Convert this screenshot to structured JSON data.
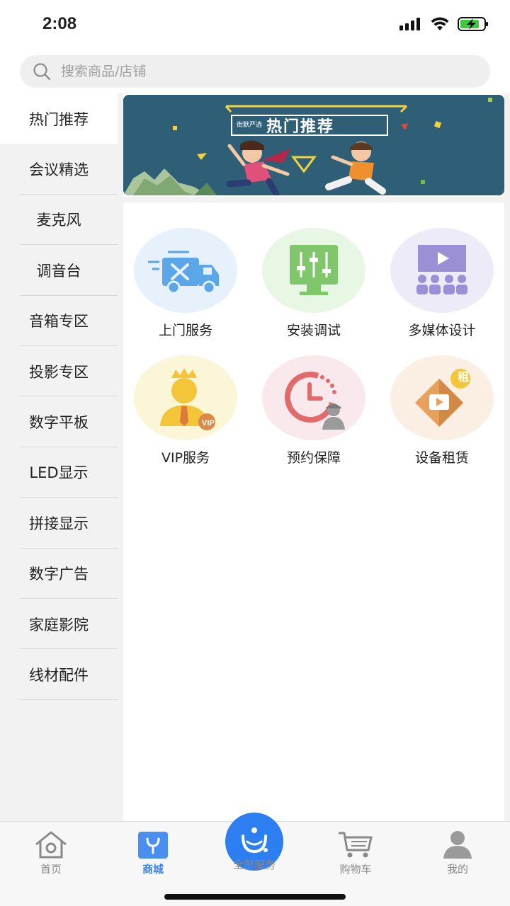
{
  "status_bar": {
    "time": "2:08"
  },
  "search": {
    "placeholder": "搜索商品/店铺"
  },
  "sidebar": {
    "items": [
      {
        "label": "热门推荐",
        "active": true
      },
      {
        "label": "会议精选"
      },
      {
        "label": "麦克风"
      },
      {
        "label": "调音台"
      },
      {
        "label": "音箱专区"
      },
      {
        "label": "投影专区"
      },
      {
        "label": "数字平板"
      },
      {
        "label": "LED显示"
      },
      {
        "label": "拼接显示"
      },
      {
        "label": "数字广告"
      },
      {
        "label": "家庭影院"
      },
      {
        "label": "线材配件"
      }
    ]
  },
  "banner": {
    "small_text": "街默严选",
    "title": "热门推荐"
  },
  "services": [
    {
      "label": "上门服务",
      "icon": "delivery-truck-icon",
      "bg": "#e6f1fb"
    },
    {
      "label": "安装调试",
      "icon": "equalizer-icon",
      "bg": "#e8f6e4"
    },
    {
      "label": "多媒体设计",
      "icon": "presentation-icon",
      "bg": "#ecebf7"
    },
    {
      "label": "VIP服务",
      "icon": "vip-user-icon",
      "bg": "#fbf6d8"
    },
    {
      "label": "预约保障",
      "icon": "clock-worker-icon",
      "bg": "#f9e9ec"
    },
    {
      "label": "设备租赁",
      "icon": "rental-play-icon",
      "bg": "#fbeee2",
      "badge": "租"
    }
  ],
  "tabbar": {
    "tabs": [
      {
        "label": "首页",
        "icon": "home-icon"
      },
      {
        "label": "商城",
        "icon": "mall-icon",
        "active": true
      },
      {
        "label": "全部服务",
        "icon": "service-icon"
      },
      {
        "label": "购物车",
        "icon": "cart-icon"
      },
      {
        "label": "我的",
        "icon": "profile-icon"
      }
    ]
  },
  "colors": {
    "accent": "#2d7ef0",
    "active_tab": "#3b83e6",
    "banner_bg": "#2f5f76"
  }
}
